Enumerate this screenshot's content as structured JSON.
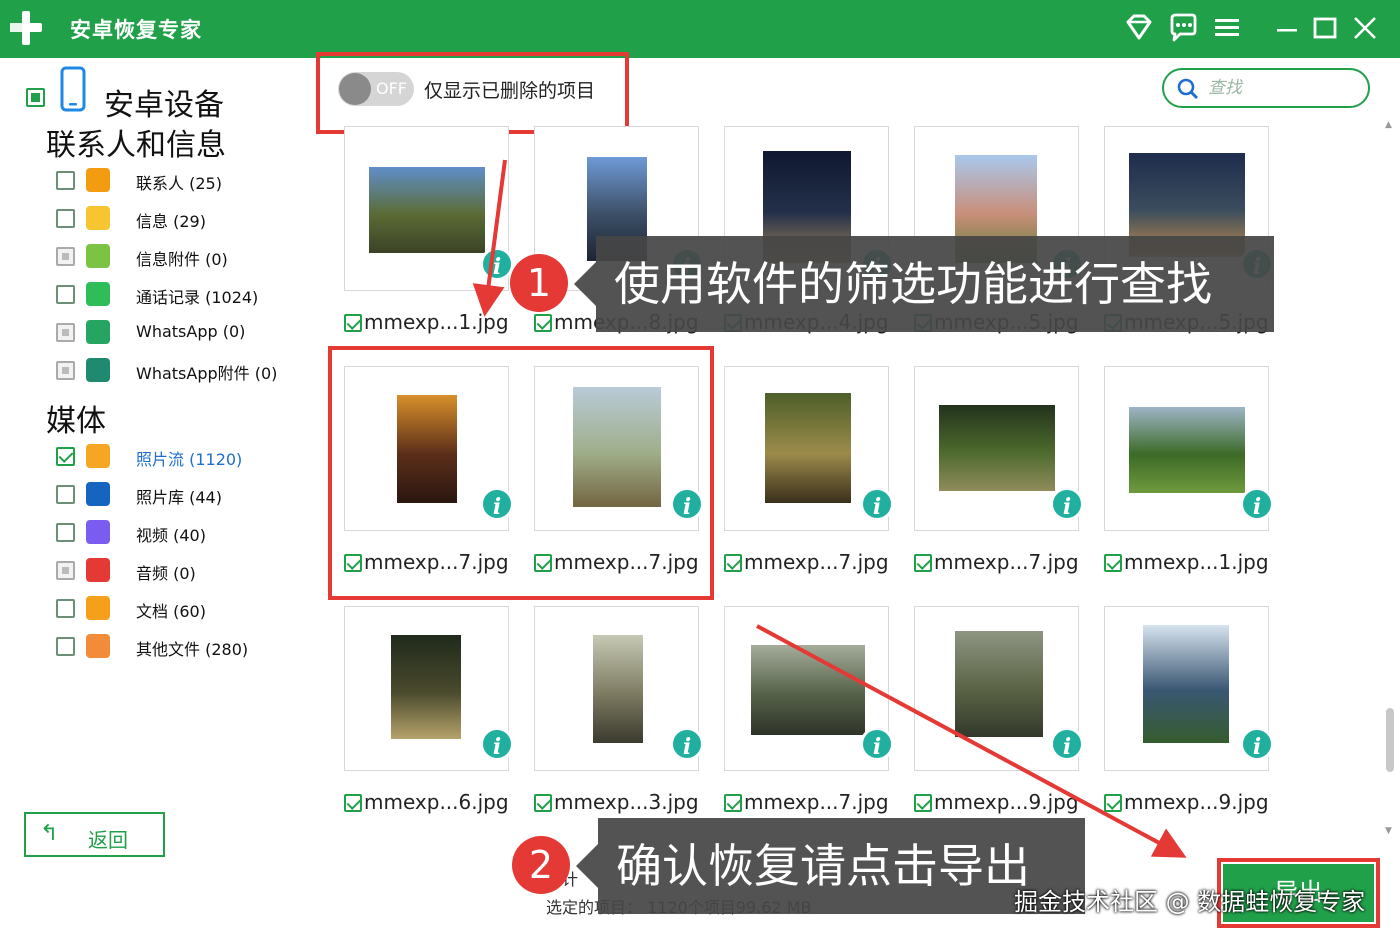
{
  "app": {
    "title": "安卓恢复专家"
  },
  "sidebar": {
    "device_label": "安卓设备",
    "contacts_section_title": "联系人和信息",
    "contact_items": [
      {
        "label": "联系人 (25)",
        "color": "#f39c12",
        "checkbox": "unchecked"
      },
      {
        "label": "信息 (29)",
        "color": "#f7c531",
        "checkbox": "unchecked"
      },
      {
        "label": "信息附件 (0)",
        "color": "#7cc243",
        "checkbox": "disabled"
      },
      {
        "label": "通话记录 (1024)",
        "color": "#2ebd59",
        "checkbox": "unchecked"
      },
      {
        "label": "WhatsApp (0)",
        "color": "#25a561",
        "checkbox": "disabled"
      },
      {
        "label": "WhatsApp附件 (0)",
        "color": "#1f8a70",
        "checkbox": "disabled"
      }
    ],
    "media_section_title": "媒体",
    "media_items": [
      {
        "label": "照片流 (1120)",
        "color": "#f5a623",
        "checkbox": "checked",
        "active": true
      },
      {
        "label": "照片库 (44)",
        "color": "#1565c0",
        "checkbox": "unchecked"
      },
      {
        "label": "视频 (40)",
        "color": "#7b5cf0",
        "checkbox": "unchecked"
      },
      {
        "label": "音频 (0)",
        "color": "#e53935",
        "checkbox": "disabled"
      },
      {
        "label": "文档 (60)",
        "color": "#f59f1b",
        "checkbox": "unchecked"
      },
      {
        "label": "其他文件 (280)",
        "color": "#f28c38",
        "checkbox": "unchecked"
      }
    ],
    "back_label": "返回"
  },
  "toolbar": {
    "toggle_state": "OFF",
    "filter_label": "仅显示已删除的项目",
    "search_placeholder": "查找"
  },
  "photos": [
    {
      "name": "mmexp...1.jpg",
      "colors": [
        "#5f8fc9",
        "#5b6b35",
        "#3b4226"
      ]
    },
    {
      "name": "mmexp...8.jpg",
      "colors": [
        "#6f9ad6",
        "#3c4f67",
        "#1d2433"
      ]
    },
    {
      "name": "mmexp...4.jpg",
      "colors": [
        "#0f1830",
        "#24304a",
        "#a5875a"
      ]
    },
    {
      "name": "mmexp...5.jpg",
      "colors": [
        "#a9c8ec",
        "#c98e79",
        "#5d7f3a"
      ]
    },
    {
      "name": "mmexp...5.jpg",
      "colors": [
        "#1e2c4d",
        "#3b4d5d",
        "#c08a4c"
      ]
    },
    {
      "name": "mmexp...7.jpg",
      "colors": [
        "#d8902b",
        "#5b2e1a",
        "#2a160f"
      ]
    },
    {
      "name": "mmexp...7.jpg",
      "colors": [
        "#b9cbd8",
        "#9fae89",
        "#736541"
      ]
    },
    {
      "name": "mmexp...7.jpg",
      "colors": [
        "#4d5f2a",
        "#9c8b4a",
        "#3a2f1c"
      ]
    },
    {
      "name": "mmexp...7.jpg",
      "colors": [
        "#23331c",
        "#4e6a2e",
        "#8f8c5b"
      ]
    },
    {
      "name": "mmexp...1.jpg",
      "colors": [
        "#9eb5c7",
        "#3c6a27",
        "#6f9a3e"
      ]
    },
    {
      "name": "mmexp...6.jpg",
      "colors": [
        "#1f2a1c",
        "#4a4a2d",
        "#b6a26b"
      ]
    },
    {
      "name": "mmexp...3.jpg",
      "colors": [
        "#c6c9b4",
        "#7d7a62",
        "#3a3a2e"
      ]
    },
    {
      "name": "mmexp...7.jpg",
      "colors": [
        "#a5ad9b",
        "#556148",
        "#2f3329"
      ]
    },
    {
      "name": "mmexp...9.jpg",
      "colors": [
        "#8d9582",
        "#5a6344",
        "#33382b"
      ]
    },
    {
      "name": "mmexp...9.jpg",
      "colors": [
        "#d7e3ef",
        "#3a5773",
        "#355c2e"
      ]
    }
  ],
  "callouts": {
    "step1_number": "1",
    "step1_text": "使用软件的筛选功能进行查找",
    "step2_number": "2",
    "step2_text": "确认恢复请点击导出"
  },
  "footer": {
    "total_label": "总计",
    "selected_label": "选定的项目： 1120个项目99.62 MB",
    "export_label": "导出"
  },
  "watermark": "掘金技术社区 @ 数据蛙恢复专家",
  "colors": {
    "brand_green": "#21a04a",
    "annotation_red": "#e53935",
    "callout_bg": "#464646",
    "info_teal": "#21b0a0"
  }
}
